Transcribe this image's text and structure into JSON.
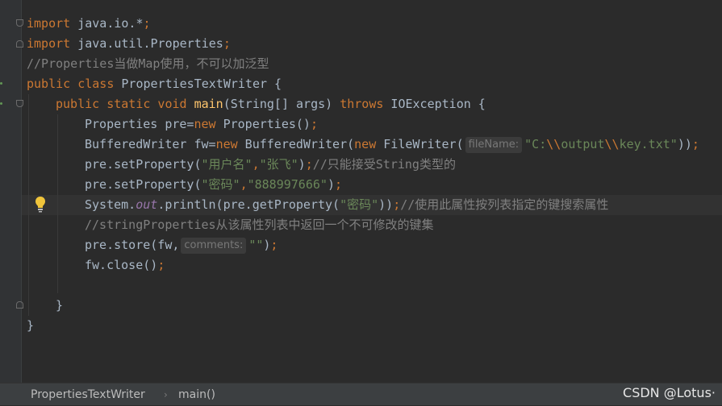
{
  "editor": {
    "lines": {
      "l1": {
        "kw": "import",
        "rest": " java.io.*",
        "semi": ";"
      },
      "l2": {
        "kw": "import",
        "rest": " java.util.Properties",
        "semi": ";"
      },
      "l3": {
        "comment": "//Properties当做Map使用，不可以加泛型"
      },
      "l4": {
        "kw1": "public",
        "kw2": " class",
        "rest": " PropertiesTextWriter {"
      },
      "l5": {
        "kw1": "public",
        "kw2": " static",
        "kw3": " void",
        "method": " main",
        "args": "(String[] args) ",
        "throws": "throws",
        "rest": " IOException {"
      },
      "l6": {
        "a": "Properties pre=",
        "new": "new",
        "b": " Properties()",
        "semi": ";"
      },
      "l7": {
        "a": "BufferedWriter fw=",
        "new1": "new",
        "b": " BufferedWriter(",
        "new2": "new",
        "c": " FileWriter(",
        "hint": "fileName:",
        "s1": "\"C:",
        "e1": "\\\\",
        "s2": "output",
        "e2": "\\\\",
        "s3": "key.txt\"",
        "d": "))",
        "semi": ";"
      },
      "l8": {
        "a": "pre.setProperty(",
        "s1": "\"用户名\"",
        "comma": ",",
        "s2": "\"张飞\"",
        "b": ")",
        "semi": ";",
        "comment": "//只能接受String类型的"
      },
      "l9": {
        "a": "pre.setProperty(",
        "s1": "\"密码\"",
        "comma": ",",
        "s2": "\"888997666\"",
        "b": ")",
        "semi": ";"
      },
      "l10": {
        "a": "System.",
        "field": "out",
        "b": ".println(pre.getProperty(",
        "s1": "\"密码\"",
        "c": "))",
        "semi": ";",
        "comment": "//使用此属性按列表指定的键搜索属性"
      },
      "l11": {
        "comment": "//stringProperties从该属性列表中返回一个不可修改的键集"
      },
      "l12": {
        "a": "pre.store(fw,",
        "hint": "comments:",
        "s1": "\"\"",
        "b": ")",
        "semi": ";"
      },
      "l13": {
        "a": "fw.close()",
        "semi": ";"
      },
      "l15": {
        "text": "}"
      },
      "l16": {
        "text": "}"
      }
    }
  },
  "breadcrumb": {
    "class_name": "PropertiesTextWriter",
    "separator": "›",
    "method_name": "main()"
  },
  "watermark": "CSDN @Lotus·",
  "colors": {
    "background": "#2b2b2b",
    "keyword": "#cc7832",
    "string": "#6a8759",
    "comment": "#808080",
    "method": "#ffc66d",
    "static_field": "#9876aa",
    "default_text": "#a9b7c6",
    "bulb": "#f0c43b"
  },
  "icons": {
    "intention": "lightbulb-icon",
    "fold": "fold-marker-icon"
  }
}
